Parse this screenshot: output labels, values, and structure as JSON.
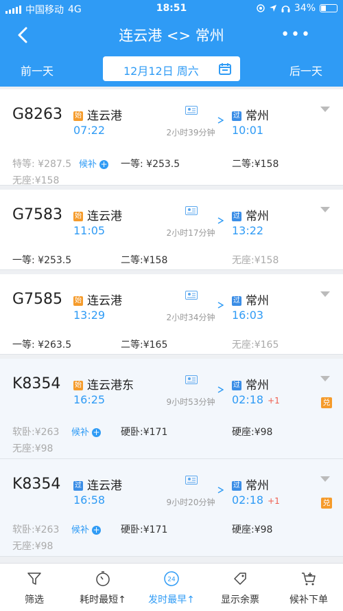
{
  "status_bar": {
    "carrier": "中国移动",
    "network": "4G",
    "time": "18:51",
    "battery": "34%",
    "battery_level": 0.34
  },
  "header": {
    "title": "连云港 <> 常州",
    "more": "•••"
  },
  "date_bar": {
    "prev": "前一天",
    "date": "12月12日 周六",
    "next": "后一天"
  },
  "trains": [
    {
      "no": "G8263",
      "dep_tag": "始",
      "dep_station": "连云港",
      "dep_time": "07:22",
      "duration": "2小时39分钟",
      "arr_tag": "过",
      "arr_station": "常州",
      "arr_time": "10:01",
      "prices": [
        {
          "label": "特等:",
          "value": "¥287.5",
          "gray": true
        },
        {
          "label": "一等:",
          "value": "¥253.5"
        },
        {
          "label": "二等:",
          "value": "¥158"
        },
        {
          "label": "无座:",
          "value": "¥158",
          "gray": true
        }
      ],
      "houbu": "候补"
    },
    {
      "no": "G7583",
      "dep_tag": "始",
      "dep_station": "连云港",
      "dep_time": "11:05",
      "duration": "2小时17分钟",
      "arr_tag": "过",
      "arr_station": "常州",
      "arr_time": "13:22",
      "prices": [
        {
          "label": "一等:",
          "value": "¥253.5"
        },
        {
          "label": "二等:",
          "value": "¥158"
        },
        {
          "label": "无座:",
          "value": "¥158",
          "gray": true
        }
      ]
    },
    {
      "no": "G7585",
      "dep_tag": "始",
      "dep_station": "连云港",
      "dep_time": "13:29",
      "duration": "2小时34分钟",
      "arr_tag": "过",
      "arr_station": "常州",
      "arr_time": "16:03",
      "prices": [
        {
          "label": "一等:",
          "value": "¥263.5"
        },
        {
          "label": "二等:",
          "value": "¥165"
        },
        {
          "label": "无座:",
          "value": "¥165",
          "gray": true
        }
      ]
    },
    {
      "no": "K8354",
      "dep_tag": "始",
      "dep_station": "连云港东",
      "dep_time": "16:25",
      "duration": "9小时53分钟",
      "arr_tag": "过",
      "arr_station": "常州",
      "arr_time": "02:18",
      "plus_day": "+1",
      "dui": "兑",
      "prices": [
        {
          "label": "软卧:",
          "value": "¥263",
          "gray": true
        },
        {
          "label": "硬卧:",
          "value": "¥171"
        },
        {
          "label": "硬座:",
          "value": "¥98"
        },
        {
          "label": "无座:",
          "value": "¥98",
          "gray": true
        }
      ],
      "houbu": "候补"
    },
    {
      "no": "K8354",
      "dep_tag": "过",
      "dep_station": "连云港",
      "dep_time": "16:58",
      "duration": "9小时20分钟",
      "arr_tag": "过",
      "arr_station": "常州",
      "arr_time": "02:18",
      "plus_day": "+1",
      "dui": "兑",
      "prices": [
        {
          "label": "软卧:",
          "value": "¥263",
          "gray": true
        },
        {
          "label": "硬卧:",
          "value": "¥171"
        },
        {
          "label": "硬座:",
          "value": "¥98"
        },
        {
          "label": "无座:",
          "value": "¥98",
          "gray": true
        }
      ],
      "houbu": "候补"
    }
  ],
  "tabs": [
    {
      "label": "筛选",
      "icon": "filter-icon"
    },
    {
      "label": "耗时最短↑",
      "icon": "stopwatch-icon"
    },
    {
      "label": "发时最早↑",
      "icon": "clock-24-icon",
      "clock_text": "24",
      "active": true
    },
    {
      "label": "显示余票",
      "icon": "ticket-tag-icon"
    },
    {
      "label": "候补下单",
      "icon": "cart-plus-icon"
    }
  ],
  "colors": {
    "primary": "#2f9bf5",
    "origin_tag": "#f59b2b",
    "pass_tag": "#3a8de6",
    "plus_day": "#ef5b4c"
  }
}
